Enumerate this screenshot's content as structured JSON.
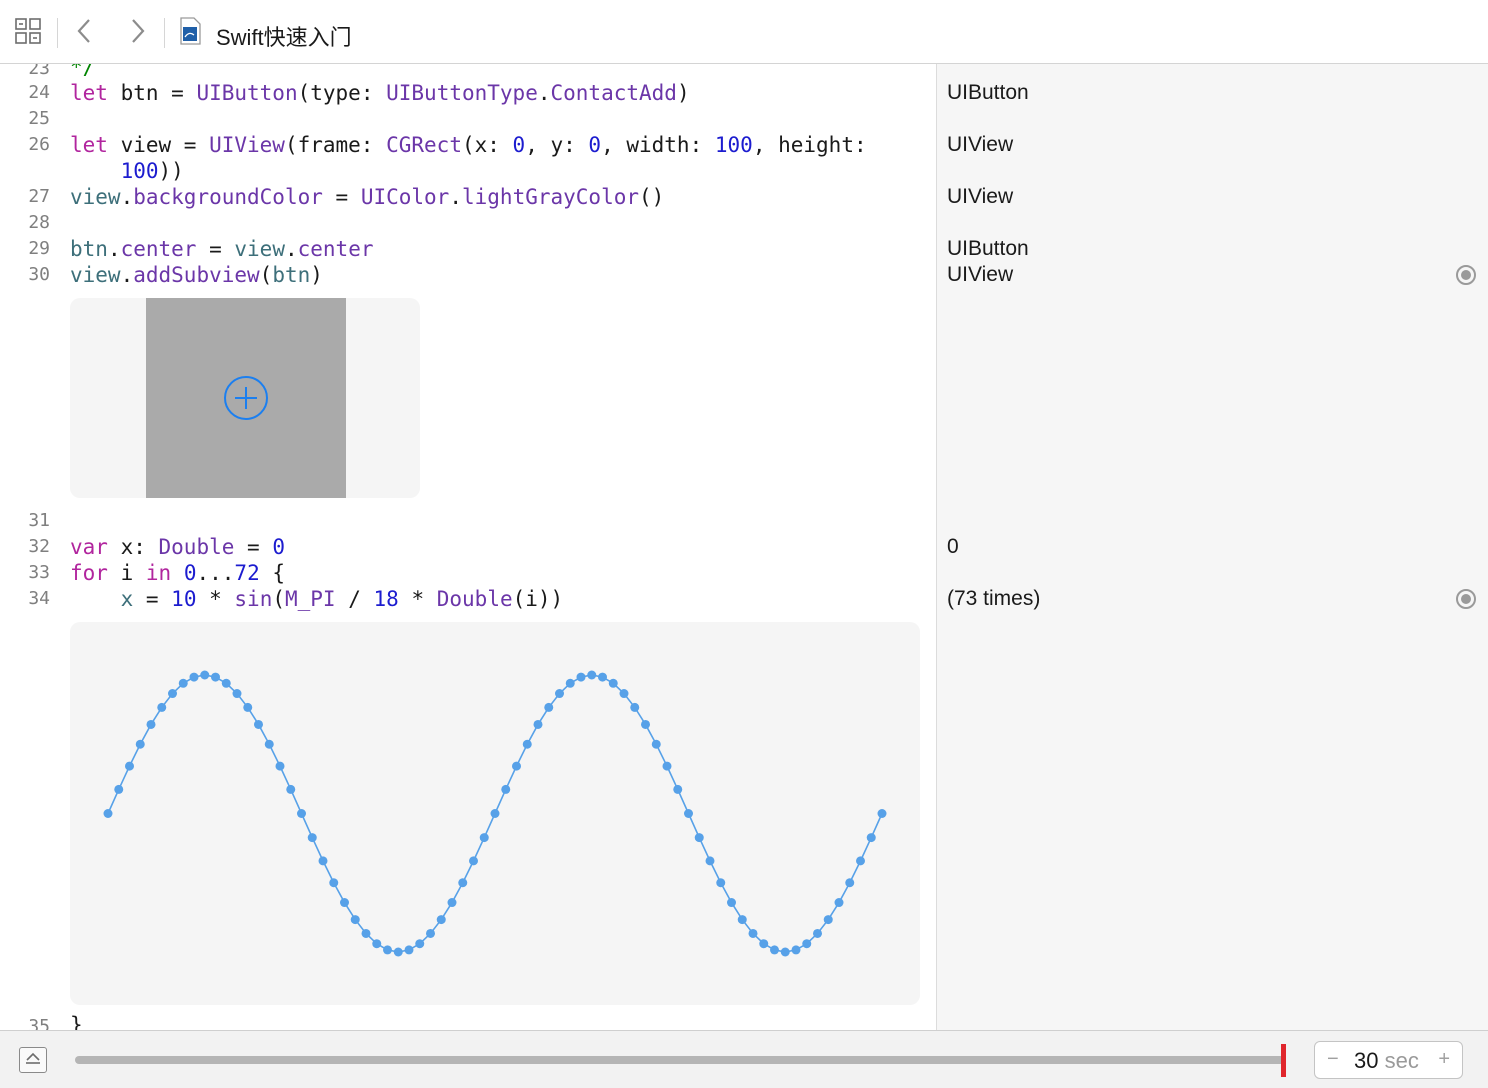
{
  "toolbar": {
    "file_title": "Swift快速入门",
    "icons": [
      "related-items-grid-icon",
      "back-chevron-icon",
      "forward-chevron-icon",
      "swift-playground-file-icon"
    ]
  },
  "gutter": {
    "lines": [
      "23",
      "24",
      "25",
      "26",
      "27",
      "28",
      "29",
      "30",
      "31",
      "32",
      "33",
      "34",
      "35"
    ]
  },
  "code": {
    "line23": "*/",
    "line24": [
      "let",
      " btn = ",
      "UIButton",
      "(type: ",
      "UIButtonType",
      ".",
      "ContactAdd",
      ")"
    ],
    "line26a": [
      "let",
      " view = ",
      "UIView",
      "(frame: ",
      "CGRect",
      "(x: ",
      "0",
      ", y: ",
      "0",
      ", width: ",
      "100",
      ", height:"
    ],
    "line26b": [
      "    ",
      "100",
      "))"
    ],
    "line27": [
      "view",
      ".",
      "backgroundColor",
      " = ",
      "UIColor",
      ".",
      "lightGrayColor",
      "()"
    ],
    "line29": [
      "btn",
      ".",
      "center",
      " = ",
      "view",
      ".",
      "center"
    ],
    "line30": [
      "view",
      ".",
      "addSubview",
      "(",
      "btn",
      ")"
    ],
    "line32": [
      "var",
      " x: ",
      "Double",
      " = ",
      "0"
    ],
    "line33": [
      "for",
      " i ",
      "in",
      " ",
      "0",
      "...",
      "72",
      " {"
    ],
    "line34": [
      "    ",
      "x",
      " = ",
      "10",
      " * ",
      "sin",
      "(",
      "M_PI",
      " / ",
      "18",
      " * ",
      "Double",
      "(i))"
    ],
    "line35": "}"
  },
  "results": {
    "r24": "UIButton",
    "r26": "UIView",
    "r27": "UIView",
    "r29": "UIButton",
    "r30": "UIView",
    "r32": "0",
    "r34": "(73 times)"
  },
  "colors": {
    "keyword": "#b1259e",
    "type": "#6b36a8",
    "member": "#3d6f7a",
    "number": "#1c1ccf",
    "comment": "#008400",
    "plot": "#57a1e8",
    "timeline_thumb": "#e0262c"
  },
  "chart_data": {
    "type": "line",
    "x": [
      0,
      1,
      2,
      3,
      4,
      5,
      6,
      7,
      8,
      9,
      10,
      11,
      12,
      13,
      14,
      15,
      16,
      17,
      18,
      19,
      20,
      21,
      22,
      23,
      24,
      25,
      26,
      27,
      28,
      29,
      30,
      31,
      32,
      33,
      34,
      35,
      36,
      37,
      38,
      39,
      40,
      41,
      42,
      43,
      44,
      45,
      46,
      47,
      48,
      49,
      50,
      51,
      52,
      53,
      54,
      55,
      56,
      57,
      58,
      59,
      60,
      61,
      62,
      63,
      64,
      65,
      66,
      67,
      68,
      69,
      70,
      71,
      72
    ],
    "values": [
      0,
      1.74,
      3.42,
      5,
      6.43,
      7.66,
      8.66,
      9.4,
      9.85,
      10,
      9.85,
      9.4,
      8.66,
      7.66,
      6.43,
      5,
      3.42,
      1.74,
      0,
      -1.74,
      -3.42,
      -5,
      -6.43,
      -7.66,
      -8.66,
      -9.4,
      -9.85,
      -10,
      -9.85,
      -9.4,
      -8.66,
      -7.66,
      -6.43,
      -5,
      -3.42,
      -1.74,
      0,
      1.74,
      3.42,
      5,
      6.43,
      7.66,
      8.66,
      9.4,
      9.85,
      10,
      9.85,
      9.4,
      8.66,
      7.66,
      6.43,
      5,
      3.42,
      1.74,
      0,
      -1.74,
      -3.42,
      -5,
      -6.43,
      -7.66,
      -8.66,
      -9.4,
      -9.85,
      -10,
      -9.85,
      -9.4,
      -8.66,
      -7.66,
      -6.43,
      -5,
      -3.42,
      -1.74,
      0
    ],
    "ylim": [
      -10,
      10
    ],
    "grid": false
  },
  "timeline": {
    "value": "30",
    "unit": "sec",
    "minus": "−",
    "plus": "+",
    "position_fraction": 1.0
  }
}
